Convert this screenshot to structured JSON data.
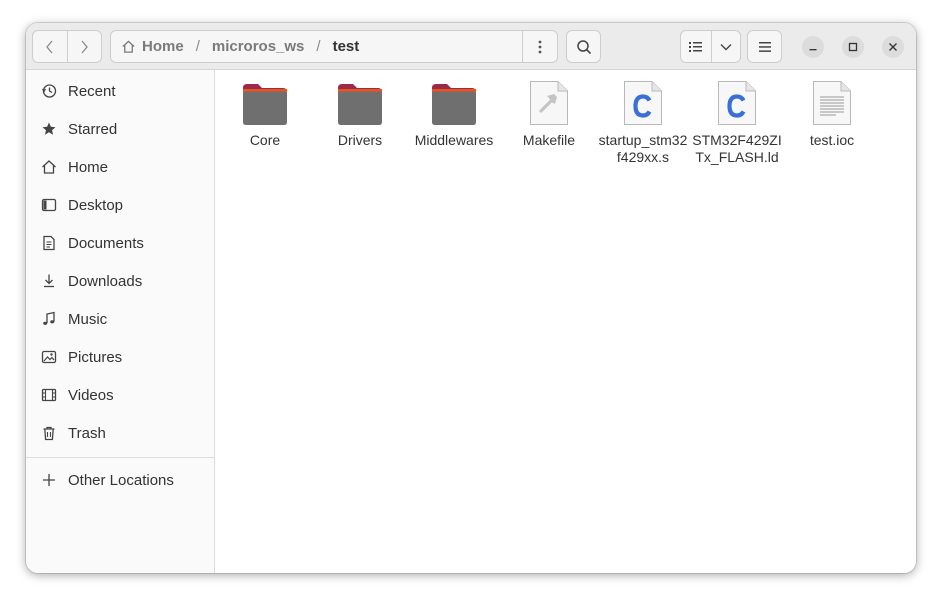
{
  "breadcrumb": {
    "home_label": "Home",
    "separator": "/",
    "items": [
      "microros_ws",
      "test"
    ]
  },
  "sidebar": {
    "items": [
      {
        "label": "Recent",
        "icon": "clock-icon"
      },
      {
        "label": "Starred",
        "icon": "star-icon"
      },
      {
        "label": "Home",
        "icon": "home-icon"
      },
      {
        "label": "Desktop",
        "icon": "desktop-icon"
      },
      {
        "label": "Documents",
        "icon": "document-icon"
      },
      {
        "label": "Downloads",
        "icon": "download-icon"
      },
      {
        "label": "Music",
        "icon": "music-icon"
      },
      {
        "label": "Pictures",
        "icon": "picture-icon"
      },
      {
        "label": "Videos",
        "icon": "video-icon"
      },
      {
        "label": "Trash",
        "icon": "trash-icon"
      }
    ],
    "other_locations": {
      "label": "Other Locations",
      "icon": "plus-icon"
    }
  },
  "files": [
    {
      "name": "Core",
      "type": "folder"
    },
    {
      "name": "Drivers",
      "type": "folder"
    },
    {
      "name": "Middlewares",
      "type": "folder"
    },
    {
      "name": "Makefile",
      "type": "makefile"
    },
    {
      "name": "startup_stm32f429xx.s",
      "type": "c-source"
    },
    {
      "name": "STM32F429ZITx_FLASH.ld",
      "type": "c-source"
    },
    {
      "name": "test.ioc",
      "type": "text"
    }
  ],
  "colors": {
    "folder_body": "#6f6f6f",
    "folder_tab": "#9b2a4a",
    "folder_accent": "#e9531e",
    "c_letter": "#3b6fd8"
  }
}
